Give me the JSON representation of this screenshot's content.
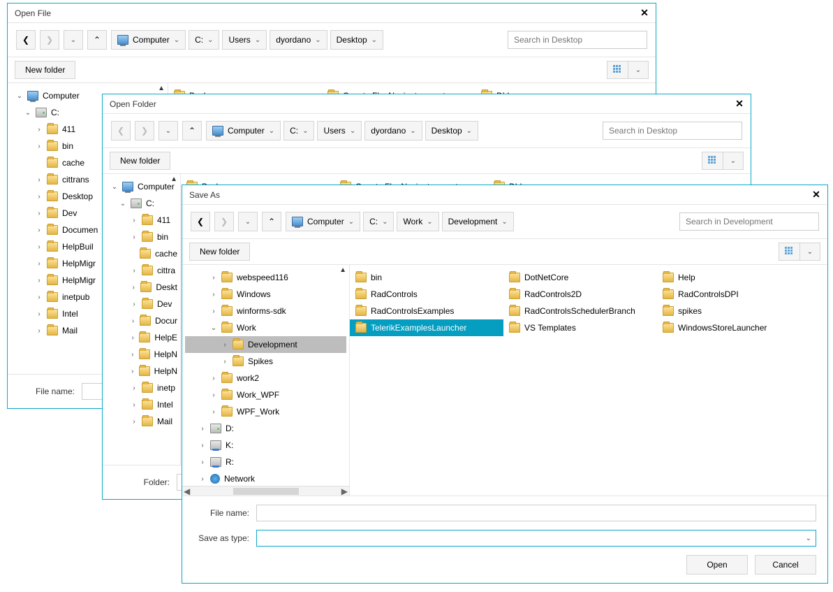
{
  "dialogs": {
    "openFile": {
      "title": "Open File",
      "new_folder": "New folder",
      "search_placeholder": "Search in Desktop",
      "filename_label": "File name:",
      "breadcrumb": [
        "Computer",
        "C:",
        "Users",
        "dyordano",
        "Desktop"
      ],
      "tree": {
        "root": "Computer",
        "drive": "C:",
        "items": [
          "411",
          "bin",
          "cache",
          "cittrans",
          "Desktop",
          "Dev",
          "Documen",
          "HelpBuil",
          "HelpMigr",
          "HelpMigr",
          "inetpub",
          "Intel",
          "Mail"
        ]
      },
      "list": [
        "Backup",
        "CountryFlagNavigator-master",
        "DLL"
      ]
    },
    "openFolder": {
      "title": "Open Folder",
      "new_folder": "New folder",
      "search_placeholder": "Search in Desktop",
      "folder_label": "Folder:",
      "breadcrumb": [
        "Computer",
        "C:",
        "Users",
        "dyordano",
        "Desktop"
      ],
      "tree": {
        "root": "Computer",
        "drive": "C:",
        "items": [
          "411",
          "bin",
          "cache",
          "cittra",
          "Deskt",
          "Dev",
          "Docur",
          "HelpE",
          "HelpN",
          "HelpN",
          "inetp",
          "Intel",
          "Mail"
        ]
      },
      "list": [
        "Backup",
        "CountryFlagNavigator-master",
        "DLL"
      ]
    },
    "saveAs": {
      "title": "Save As",
      "new_folder": "New folder",
      "search_placeholder": "Search in Development",
      "filename_label": "File name:",
      "save_as_type_label": "Save as type:",
      "open_btn": "Open",
      "cancel_btn": "Cancel",
      "breadcrumb": [
        "Computer",
        "C:",
        "Work",
        "Development"
      ],
      "tree": {
        "items_top": [
          "webspeed116",
          "Windows",
          "winforms-sdk"
        ],
        "work": "Work",
        "work_children": [
          "Development",
          "Spikes"
        ],
        "items_after": [
          "work2",
          "Work_WPF",
          "WPF_Work"
        ],
        "drives": [
          "D:",
          "K:",
          "R:"
        ],
        "network": "Network"
      },
      "list_col1": [
        "bin",
        "RadControls",
        "RadControlsExamples",
        "TelerikExamplesLauncher"
      ],
      "list_col2": [
        "DotNetCore",
        "RadControls2D",
        "RadControlsSchedulerBranch",
        "VS Templates"
      ],
      "list_col3": [
        "Help",
        "RadControlsDPI",
        "spikes",
        "WindowsStoreLauncher"
      ],
      "selected": "TelerikExamplesLauncher"
    }
  }
}
